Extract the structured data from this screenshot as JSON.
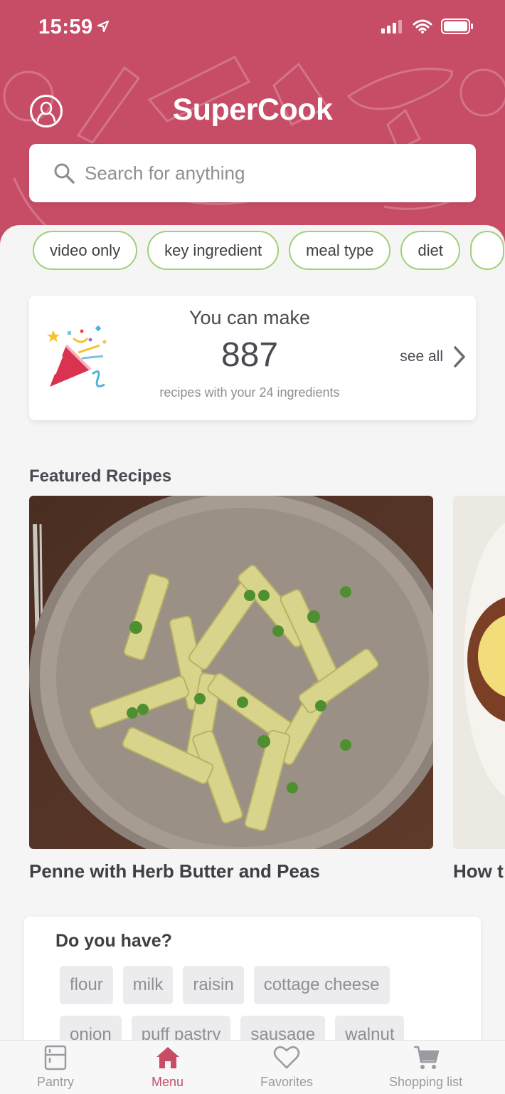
{
  "status": {
    "time": "15:59"
  },
  "header": {
    "title": "SuperCook"
  },
  "search": {
    "placeholder": "Search for anything"
  },
  "filters": [
    "video only",
    "key ingredient",
    "meal type",
    "diet"
  ],
  "summary": {
    "label": "You can make",
    "count": "887",
    "subtext": "recipes with your 24 ingredients",
    "see_all": "see all"
  },
  "featured": {
    "title": "Featured Recipes",
    "recipes": [
      {
        "title": "Penne with Herb Butter and Peas"
      },
      {
        "title": "How t"
      }
    ]
  },
  "have": {
    "title": "Do you have?",
    "ingredients": [
      "flour",
      "milk",
      "raisin",
      "cottage cheese",
      "onion",
      "puff pastry",
      "sausage",
      "walnut"
    ]
  },
  "tabs": [
    {
      "label": "Pantry",
      "icon": "pantry-icon"
    },
    {
      "label": "Menu",
      "icon": "home-icon"
    },
    {
      "label": "Favorites",
      "icon": "heart-icon"
    },
    {
      "label": "Shopping list",
      "icon": "cart-icon"
    }
  ],
  "colors": {
    "brand": "#c74d67",
    "chip_border": "#9fd277",
    "background": "#f5f5f6"
  }
}
